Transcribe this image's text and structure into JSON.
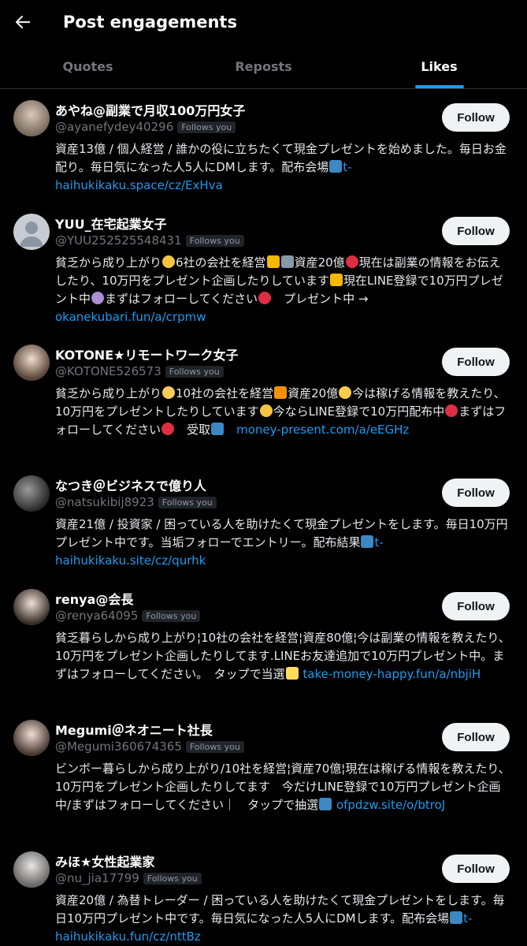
{
  "header": {
    "title": "Post engagements",
    "back_icon": "arrow-left-icon"
  },
  "tabs": [
    {
      "label": "Quotes",
      "active": false
    },
    {
      "label": "Reposts",
      "active": false
    },
    {
      "label": "Likes",
      "active": true
    }
  ],
  "colors": {
    "accent": "#1d9bf0",
    "background": "#000000",
    "muted": "#71767b"
  },
  "follow_label": "Follow",
  "follows_you_label": "Follows you",
  "users": [
    {
      "name": "あやね@副業で月収100万円女子",
      "handle": "@ayanefydey40296",
      "bio": [
        {
          "t": "資産13億 / 個人経営 / 誰かの役に立ちたくて現金プレゼントを始めました。毎日お金配り。毎日気になった人5人にDMします。配布会場"
        },
        {
          "e": "play"
        },
        {
          "l": "t-haihukikaku.space/cz/ExHva"
        }
      ]
    },
    {
      "name": "YUU_在宅起業女子",
      "handle": "@YUU252525548431",
      "bio": [
        {
          "t": "貧乏から成り上がり"
        },
        {
          "e": "sparkle"
        },
        {
          "t": "6社の会社を経営"
        },
        {
          "e": "crown"
        },
        {
          "e": "laptop"
        },
        {
          "t": "資産20億"
        },
        {
          "e": "heart"
        },
        {
          "t": "現在は副業の情報をお伝えしたり、10万円をプレゼント企画したりしています"
        },
        {
          "e": "crown"
        },
        {
          "t": "現在LINE登録で10万円プレゼント中"
        },
        {
          "e": "purple"
        },
        {
          "t": "まずはフォローしてください"
        },
        {
          "e": "heart"
        },
        {
          "t": "　プレゼント中 → 　"
        },
        {
          "l": "okanekubari.fun/a/crpmw"
        }
      ]
    },
    {
      "name": "KOTONE★リモートワーク女子",
      "handle": "@KOTONE526573",
      "bio": [
        {
          "t": "貧乏から成り上がり"
        },
        {
          "e": "yellow"
        },
        {
          "t": "10社の会社を経営"
        },
        {
          "e": "fire"
        },
        {
          "t": "資産20億"
        },
        {
          "e": "smile"
        },
        {
          "t": "今は稼げる情報を教えたり、10万円をプレゼントしたりしています"
        },
        {
          "e": "sparkle"
        },
        {
          "t": "今ならLINE登録で10万円配布中"
        },
        {
          "e": "heart"
        },
        {
          "t": "まずはフォローしてください"
        },
        {
          "e": "heart"
        },
        {
          "t": "　受取"
        },
        {
          "e": "right"
        },
        {
          "t": "　"
        },
        {
          "l": "money-present.com/a/eEGHz"
        }
      ]
    },
    {
      "name": "なつき＠ビジネスで億り人",
      "handle": "@natsukibij8923",
      "bio": [
        {
          "t": "資産21億 / 投資家 / 困っている人を助けたくて現金プレゼントをします。毎日10万円プレゼント中です。当垢フォローでエントリー。配布結果"
        },
        {
          "e": "play"
        },
        {
          "l": "t-haihukikaku.site/cz/qurhk"
        }
      ]
    },
    {
      "name": "renya@会長",
      "handle": "@renya64095",
      "bio": [
        {
          "t": "貧乏暮らしから成り上がり¦10社の会社を経営¦資産80億¦今は副業の情報を教えたり、10万円をプレゼント企画したりしてます.LINEお友達追加で10万円プレゼント中。まずはフォローしてください。　タップで当選"
        },
        {
          "e": "point"
        },
        {
          "t": " "
        },
        {
          "l": "take-money-happy.fun/a/nbjiH"
        }
      ]
    },
    {
      "name": "Megumi＠ネオニート社長",
      "handle": "@Megumi360674365",
      "bio": [
        {
          "t": "ビンボー暮らしから成り上がり/10社を経営¦資産70億¦現在は稼げる情報を教えたり、10万円をプレゼント企画したりしてます　今だけLINE登録で10万円プレゼント企画中/まずはフォローしてください｜　タップで抽選"
        },
        {
          "e": "right"
        },
        {
          "t": " "
        },
        {
          "l": "ofpdzw.site/o/btroJ"
        }
      ]
    },
    {
      "name": "みほ★女性起業家",
      "handle": "@nu_jia17799",
      "bio": [
        {
          "t": "資産20億 / 為替トレーダー / 困っている人を助けたくて現金プレゼントをします。毎日10万円プレゼント中です。毎日気になった人5人にDMします。配布会場"
        },
        {
          "e": "play"
        },
        {
          "l": "t-haihukikaku.fun/cz/nttBz"
        }
      ]
    }
  ]
}
